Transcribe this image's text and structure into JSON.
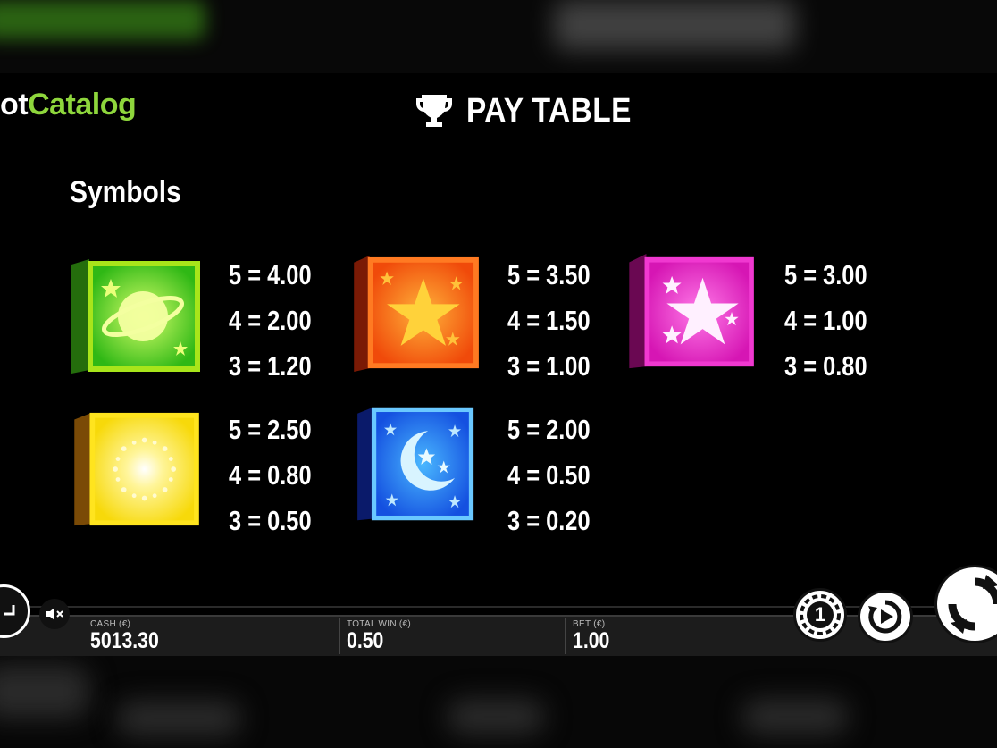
{
  "logo": {
    "part1": "ot",
    "part2": "Catalog"
  },
  "header": {
    "title": "PAY TABLE"
  },
  "section": {
    "title": "Symbols"
  },
  "symbols": [
    {
      "name": "green-planet",
      "pays": [
        "5 = 4.00",
        "4 = 2.00",
        "3 = 1.20"
      ]
    },
    {
      "name": "orange-star",
      "pays": [
        "5 = 3.50",
        "4 = 1.50",
        "3 = 1.00"
      ]
    },
    {
      "name": "pink-star",
      "pays": [
        "5 = 3.00",
        "4 = 1.00",
        "3 = 0.80"
      ]
    },
    {
      "name": "yellow-sun",
      "pays": [
        "5 = 2.50",
        "4 = 0.80",
        "3 = 0.50"
      ]
    },
    {
      "name": "blue-moon",
      "pays": [
        "5 = 2.00",
        "4 = 0.50",
        "3 = 0.20"
      ]
    }
  ],
  "bottom_bar": {
    "cash_label": "CASH (€)",
    "cash_value": "5013.30",
    "win_label": "TOTAL WIN (€)",
    "win_value": "0.50",
    "bet_label": "BET (€)",
    "bet_value": "1.00"
  },
  "buttons": {
    "coin_value": "1"
  },
  "icons": [
    "trophy-icon",
    "mute-icon",
    "coin-icon",
    "autoplay-icon",
    "spin-icon",
    "back-icon"
  ],
  "colors": {
    "brand_green": "#8ed63c",
    "green_tile": "#3fd21e",
    "orange_tile": "#ff5a10",
    "pink_tile": "#e81cc0",
    "yellow_tile": "#ffe817",
    "blue_tile": "#1f74ff"
  }
}
